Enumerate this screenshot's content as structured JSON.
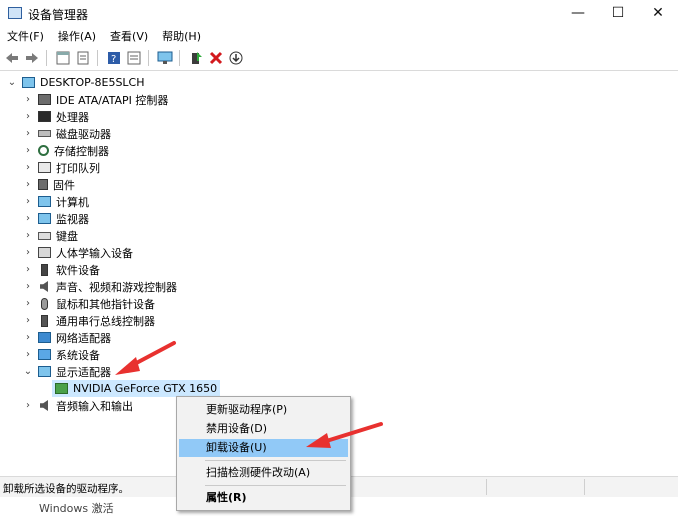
{
  "window": {
    "title": "设备管理器",
    "controls": [
      "minimize-icon",
      "maximize-icon",
      "close-icon"
    ]
  },
  "menu": [
    "文件(F)",
    "操作(A)",
    "查看(V)",
    "帮助(H)"
  ],
  "toolbar_icons": [
    "back-arrow-icon",
    "forward-arrow-icon",
    "properties-icon",
    "view-icon",
    "help-icon",
    "monitor-scan-icon",
    "update-driver-icon",
    "uninstall-x-icon",
    "download-icon"
  ],
  "tree": {
    "root": "DESKTOP-8E5SLCH",
    "categories": [
      {
        "label": "IDE ATA/ATAPI 控制器",
        "icon": "ide-controller-icon"
      },
      {
        "label": "处理器",
        "icon": "processor-icon"
      },
      {
        "label": "磁盘驱动器",
        "icon": "disk-drive-icon"
      },
      {
        "label": "存储控制器",
        "icon": "storage-controller-icon"
      },
      {
        "label": "打印队列",
        "icon": "printer-icon"
      },
      {
        "label": "固件",
        "icon": "firmware-icon"
      },
      {
        "label": "计算机",
        "icon": "computer-icon"
      },
      {
        "label": "监视器",
        "icon": "monitor-icon"
      },
      {
        "label": "键盘",
        "icon": "keyboard-icon"
      },
      {
        "label": "人体学输入设备",
        "icon": "hid-icon"
      },
      {
        "label": "软件设备",
        "icon": "software-device-icon"
      },
      {
        "label": "声音、视频和游戏控制器",
        "icon": "sound-icon"
      },
      {
        "label": "鼠标和其他指针设备",
        "icon": "mouse-icon"
      },
      {
        "label": "通用串行总线控制器",
        "icon": "usb-icon"
      },
      {
        "label": "网络适配器",
        "icon": "network-adapter-icon"
      },
      {
        "label": "系统设备",
        "icon": "system-device-icon"
      },
      {
        "label": "显示适配器",
        "icon": "display-adapter-icon",
        "expanded": true
      },
      {
        "label": "音频输入和输出",
        "icon": "audio-io-icon"
      }
    ],
    "expanded_child": "NVIDIA GeForce GTX 1650"
  },
  "context_menu": {
    "items": [
      "更新驱动程序(P)",
      "禁用设备(D)",
      "卸载设备(U)",
      "扫描检测硬件改动(A)",
      "属性(R)"
    ],
    "highlighted": "卸载设备(U)",
    "bold": "属性(R)"
  },
  "statusbar": {
    "text": "卸载所选设备的驱动程序。"
  },
  "watermark": "Windows 激活",
  "colors": {
    "selection": "#cce8ff",
    "menu_highlight": "#91c9f7",
    "annotation_arrow": "#e8312f"
  }
}
